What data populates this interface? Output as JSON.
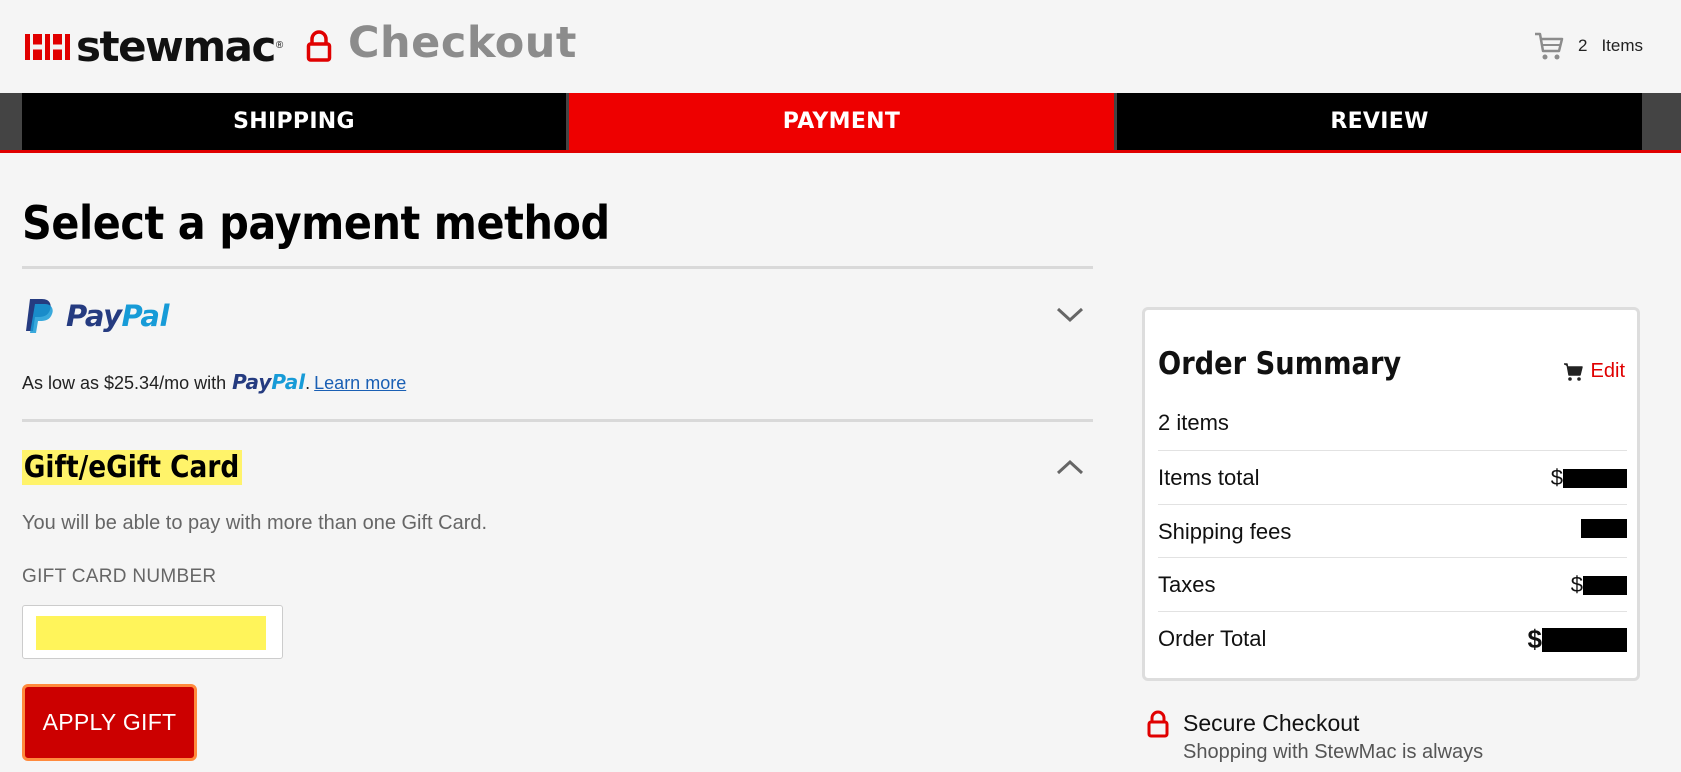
{
  "header": {
    "logo_text": "stewmac",
    "logo_registered": "®",
    "title": "Checkout",
    "cart_count": "2",
    "cart_label": "Items"
  },
  "steps": [
    {
      "label": "SHIPPING",
      "state": "complete"
    },
    {
      "label": "PAYMENT",
      "state": "active"
    },
    {
      "label": "REVIEW",
      "state": "upcoming"
    }
  ],
  "main": {
    "title": "Select a payment method",
    "paypal": {
      "logo_word_part1": "Pay",
      "logo_word_part2": "Pal",
      "note_prefix": "As low as $25.34/mo with",
      "note_suffix": ".",
      "learn_more": "Learn more",
      "expanded": false
    },
    "gift": {
      "heading": "Gift/eGift Card",
      "description": "You will be able to pay with more than one Gift Card.",
      "field_label": "GIFT CARD NUMBER",
      "field_value": "",
      "apply_button": "APPLY GIFT",
      "expanded": true
    }
  },
  "summary": {
    "title": "Order Summary",
    "edit": "Edit",
    "item_count": "2 items",
    "rows": [
      {
        "label": "Items total",
        "value_prefix": "$",
        "redacted": true
      },
      {
        "label": "Shipping fees",
        "value_prefix": "",
        "redacted": true
      },
      {
        "label": "Taxes",
        "value_prefix": "$",
        "redacted": true
      },
      {
        "label": "Order Total",
        "value_prefix": "$",
        "redacted": true
      }
    ]
  },
  "secure": {
    "title": "Secure Checkout",
    "subtitle": "Shopping with StewMac is always"
  },
  "colors": {
    "brand_red": "#e00000",
    "active_tab": "#ee0000",
    "inactive_tab": "#000000",
    "highlight_yellow": "#fff36a",
    "paypal_dark": "#253b80",
    "paypal_light": "#179bd7",
    "link_blue": "#1a5fb4"
  },
  "icons": [
    "logo-mark-icon",
    "lock-icon",
    "cart-icon",
    "chevron-down-icon",
    "chevron-up-icon",
    "paypal-p-icon",
    "small-cart-icon"
  ]
}
